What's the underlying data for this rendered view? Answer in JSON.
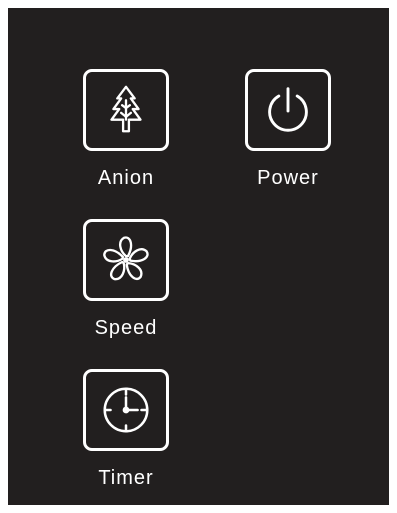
{
  "controls": [
    {
      "id": "anion",
      "label": "Anion",
      "icon": "tree-icon"
    },
    {
      "id": "power",
      "label": "Power",
      "icon": "power-icon"
    },
    {
      "id": "speed",
      "label": "Speed",
      "icon": "fan-icon"
    },
    {
      "id": "timer",
      "label": "Timer",
      "icon": "clock-icon"
    }
  ],
  "colors": {
    "panel_background": "#221f1f",
    "foreground": "#ffffff"
  }
}
